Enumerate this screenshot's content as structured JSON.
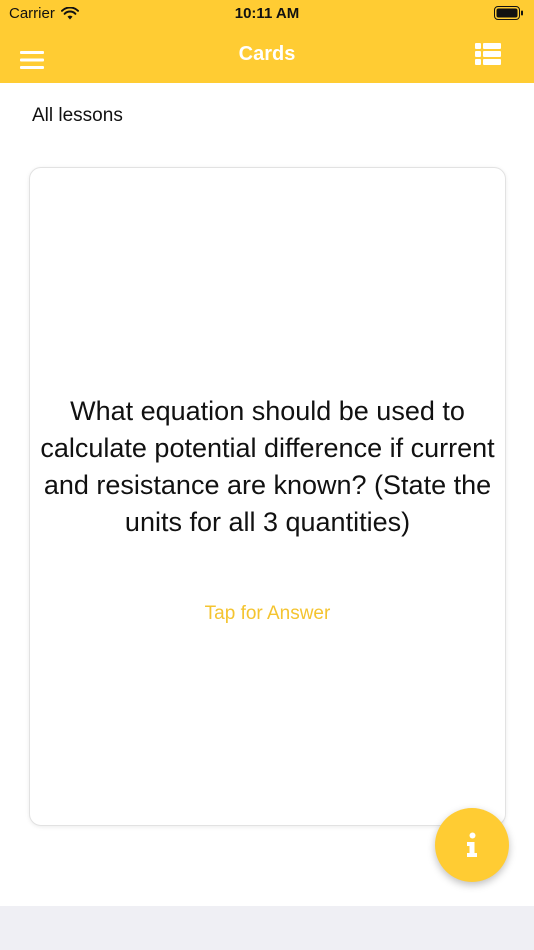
{
  "status": {
    "carrier": "Carrier",
    "time": "10:11 AM",
    "icons": [
      "wifi-icon",
      "battery-icon"
    ]
  },
  "navbar": {
    "title": "Cards",
    "left_icon": "hamburger-menu-icon",
    "right_icon": "list-icon"
  },
  "breadcrumb": "All lessons",
  "card": {
    "question": "What equation should be used to calculate potential difference if current and resistance are known? (State the units for all 3 quantities)",
    "hint": "Tap for Answer"
  },
  "fab": {
    "icon": "info-icon"
  },
  "colors": {
    "accent": "#FFCC33",
    "hint_text": "#F4C430",
    "bottom_bar": "#EFEFF4"
  }
}
